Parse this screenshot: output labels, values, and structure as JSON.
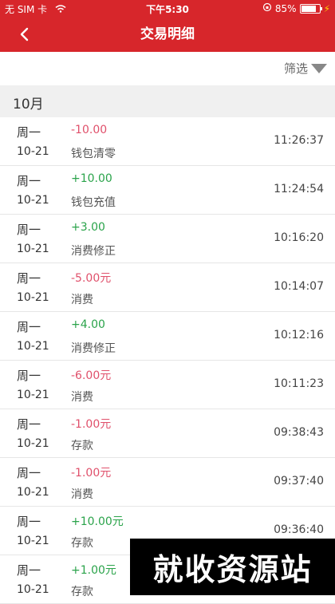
{
  "status_bar": {
    "carrier": "无 SIM 卡",
    "time": "下午5:30",
    "battery": "85%"
  },
  "nav": {
    "title": "交易明细"
  },
  "filter": {
    "label": "筛选"
  },
  "month": {
    "label": "10月"
  },
  "transactions": [
    {
      "day": "周一",
      "date": "10-21",
      "amount": "-10.00",
      "type": "钱包清零",
      "time": "11:26:37",
      "sign": "neg"
    },
    {
      "day": "周一",
      "date": "10-21",
      "amount": "+10.00",
      "type": "钱包充值",
      "time": "11:24:54",
      "sign": "pos"
    },
    {
      "day": "周一",
      "date": "10-21",
      "amount": "+3.00",
      "type": "消费修正",
      "time": "10:16:20",
      "sign": "pos"
    },
    {
      "day": "周一",
      "date": "10-21",
      "amount": "-5.00元",
      "type": "消费",
      "time": "10:14:07",
      "sign": "neg"
    },
    {
      "day": "周一",
      "date": "10-21",
      "amount": "+4.00",
      "type": "消费修正",
      "time": "10:12:16",
      "sign": "pos"
    },
    {
      "day": "周一",
      "date": "10-21",
      "amount": "-6.00元",
      "type": "消费",
      "time": "10:11:23",
      "sign": "neg"
    },
    {
      "day": "周一",
      "date": "10-21",
      "amount": "-1.00元",
      "type": "存款",
      "time": "09:38:43",
      "sign": "neg"
    },
    {
      "day": "周一",
      "date": "10-21",
      "amount": "-1.00元",
      "type": "消费",
      "time": "09:37:40",
      "sign": "neg"
    },
    {
      "day": "周一",
      "date": "10-21",
      "amount": "+10.00元",
      "type": "存款",
      "time": "09:36:40",
      "sign": "pos"
    },
    {
      "day": "周一",
      "date": "10-21",
      "amount": "+1.00元",
      "type": "存款",
      "time": "",
      "sign": "pos"
    }
  ],
  "watermark": {
    "text": "就收资源站"
  },
  "colors": {
    "brand_red": "#d7262b",
    "negative": "#e0506b",
    "positive": "#2aa34a"
  }
}
